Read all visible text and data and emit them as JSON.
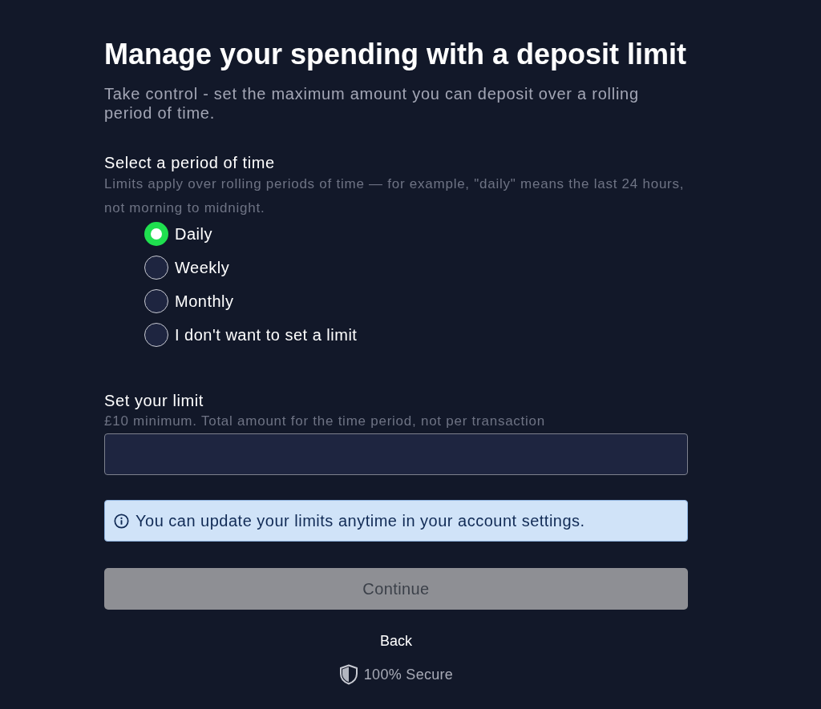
{
  "heading": {
    "title": "Manage your spending with a deposit limit",
    "subtitle": "Take control - set the maximum amount you can deposit over a rolling period of time."
  },
  "period": {
    "label": "Select a period of time",
    "help": "Limits apply over rolling periods of time — for example, \"daily\" means the last 24 hours, not morning to midnight.",
    "options": [
      {
        "label": "Daily",
        "selected": true
      },
      {
        "label": "Weekly",
        "selected": false
      },
      {
        "label": "Monthly",
        "selected": false
      },
      {
        "label": "I don't want to set a limit",
        "selected": false
      }
    ]
  },
  "limit": {
    "label": "Set your limit",
    "hint": "£10 minimum. Total amount for the time period, not per transaction"
  },
  "notice": {
    "text": "You can update your limits anytime in your account settings."
  },
  "continue_button": {
    "label": "Continue",
    "disabled": true
  },
  "back_link": {
    "label": "Back"
  },
  "security": {
    "label": "100% Secure"
  }
}
